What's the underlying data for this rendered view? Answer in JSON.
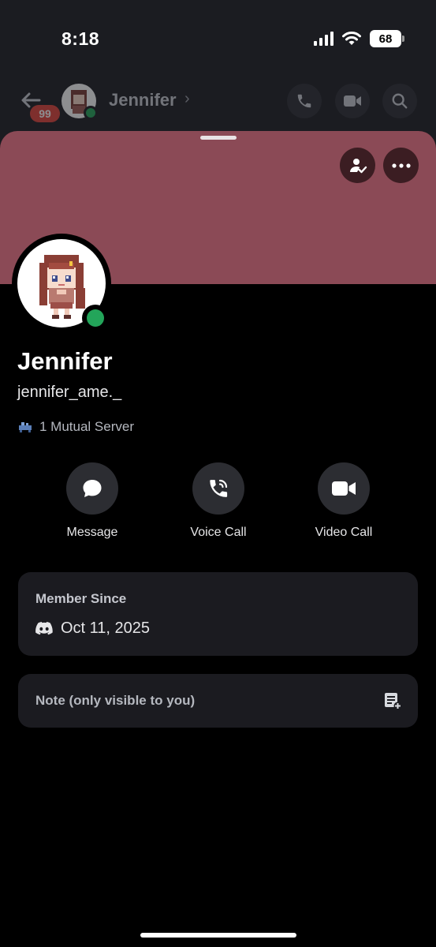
{
  "status_bar": {
    "time": "8:18",
    "battery": "68"
  },
  "chat_header": {
    "badge": "99",
    "name": "Jennifer",
    "chevron": "›"
  },
  "profile": {
    "display_name": "Jennifer",
    "username": "jennifer_ame._",
    "mutual_servers": "1 Mutual Server",
    "status": "online",
    "banner_color": "#8b4a56"
  },
  "actions": [
    {
      "label": "Message",
      "icon": "chat-bubble-icon"
    },
    {
      "label": "Voice Call",
      "icon": "phone-icon"
    },
    {
      "label": "Video Call",
      "icon": "video-camera-icon"
    }
  ],
  "member_since": {
    "title": "Member Since",
    "date": "Oct 11, 2025"
  },
  "note": {
    "placeholder": "Note (only visible to you)"
  },
  "colors": {
    "online": "#23a55a",
    "badge": "#e0433a",
    "card_bg": "#1b1b20"
  }
}
